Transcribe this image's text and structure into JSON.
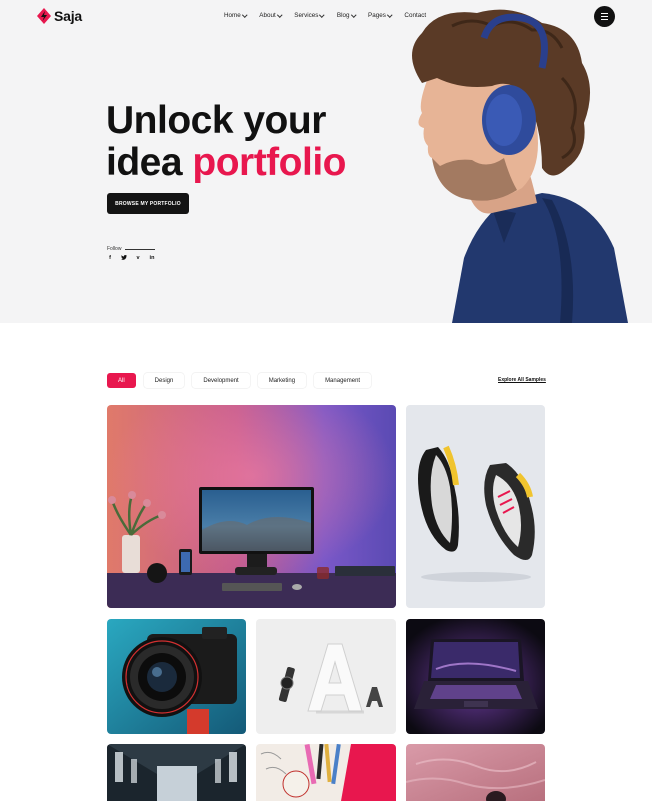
{
  "brand": {
    "name": "Saja",
    "accent_color": "#e8174e"
  },
  "nav": {
    "items": [
      {
        "label": "Home",
        "has_dropdown": true
      },
      {
        "label": "About",
        "has_dropdown": true
      },
      {
        "label": "Services",
        "has_dropdown": true
      },
      {
        "label": "Blog",
        "has_dropdown": true
      },
      {
        "label": "Pages",
        "has_dropdown": true
      },
      {
        "label": "Contact",
        "has_dropdown": false
      }
    ],
    "menu_icon": "hamburger-menu-icon"
  },
  "hero": {
    "title_line1": "Unlock your",
    "title_line2_plain": "idea ",
    "title_line2_accent": "portfolio",
    "cta_label": "BROWSE MY PORTFOLIO",
    "follow_label": "Follow",
    "socials": [
      {
        "label": "f",
        "icon": "facebook-icon"
      },
      {
        "label": "t",
        "icon": "twitter-icon"
      },
      {
        "label": "v",
        "icon": "vimeo-icon"
      },
      {
        "label": "in",
        "icon": "linkedin-icon"
      }
    ]
  },
  "portfolio": {
    "filters": [
      "All",
      "Design",
      "Development",
      "Marketing",
      "Management"
    ],
    "active_filter": "All",
    "explore_label": "Explore All Samples",
    "items": [
      {
        "subject": "desk-monitor-photo"
      },
      {
        "subject": "sneakers-photo"
      },
      {
        "subject": "camera-photo"
      },
      {
        "subject": "typography-letter-a-photo"
      },
      {
        "subject": "laptop-photo"
      },
      {
        "subject": "hallway-photo"
      },
      {
        "subject": "stationery-photo"
      },
      {
        "subject": "pink-water-photo"
      }
    ]
  }
}
